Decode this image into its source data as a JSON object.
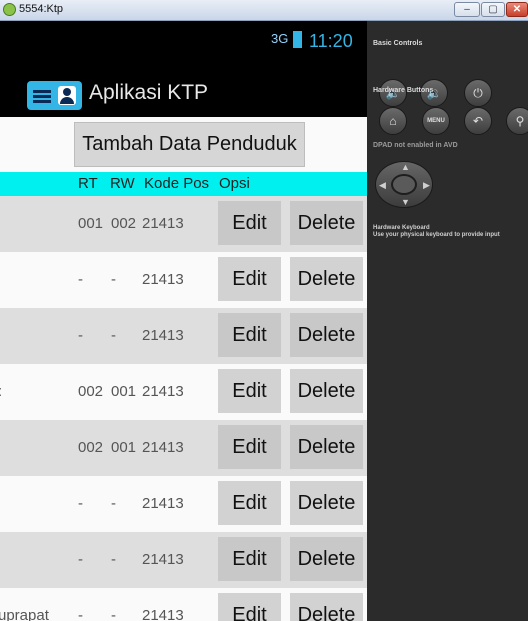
{
  "window": {
    "title": "5554:Ktp",
    "buttons": {
      "minimize": "–",
      "maximize": "▢",
      "close": "✕"
    }
  },
  "status_bar": {
    "network": "3G",
    "time": "11:20"
  },
  "action_bar": {
    "title": "Aplikasi KTP",
    "logo_text": "KTP"
  },
  "add_button": "Tambah Data Penduduk",
  "table": {
    "headers": [
      "RT",
      "RW",
      "Kode Pos",
      "Opsi"
    ],
    "rows": [
      {
        "name": "",
        "rt": "001",
        "rw": "002",
        "kode_pos": "21413",
        "edit": "Edit",
        "delete": "Delete"
      },
      {
        "name": "",
        "rt": "-",
        "rw": "-",
        "kode_pos": "21413",
        "edit": "Edit",
        "delete": "Delete"
      },
      {
        "name": "",
        "rt": "-",
        "rw": "-",
        "kode_pos": "21413",
        "edit": "Edit",
        "delete": "Delete"
      },
      {
        "name": ":",
        "rt": "002",
        "rw": "001",
        "kode_pos": "21413",
        "edit": "Edit",
        "delete": "Delete"
      },
      {
        "name": "",
        "rt": "002",
        "rw": "001",
        "kode_pos": "21413",
        "edit": "Edit",
        "delete": "Delete"
      },
      {
        "name": "",
        "rt": "-",
        "rw": "-",
        "kode_pos": "21413",
        "edit": "Edit",
        "delete": "Delete"
      },
      {
        "name": "",
        "rt": "-",
        "rw": "-",
        "kode_pos": "21413",
        "edit": "Edit",
        "delete": "Delete"
      },
      {
        "name": "uprapat",
        "rt": "-",
        "rw": "-",
        "kode_pos": "21413",
        "edit": "Edit",
        "delete": "Delete"
      }
    ]
  },
  "emulator_panel": {
    "basic_controls": "Basic Controls",
    "hardware_buttons": "Hardware Buttons",
    "menu_label": "MENU",
    "dpad": "DPAD not enabled in AVD",
    "keyboard_title": "Hardware Keyboard",
    "keyboard_hint": "Use your physical keyboard to provide input"
  },
  "colors": {
    "header_row": "#00f0f0",
    "accent": "#33b5e5",
    "row_shade": "#dedede"
  }
}
